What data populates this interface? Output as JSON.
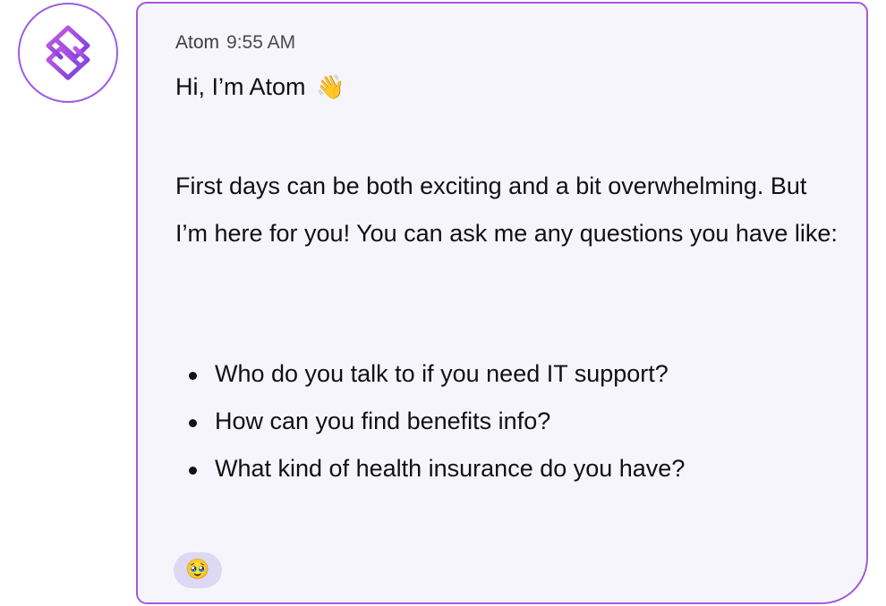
{
  "sender": {
    "name": "Atom",
    "time": "9:55 AM",
    "avatar_icon": "atom-logo-icon"
  },
  "message": {
    "greeting": "Hi, I’m Atom",
    "greeting_emoji": "👋",
    "intro": "First days can be both exciting and a bit overwhelming. But I’m here for you! You can ask me any questions you have like:",
    "examples": [
      "Who do you talk to if you need IT support?",
      "How can you find benefits info?",
      "What kind of health insurance do you have?"
    ]
  },
  "reaction": {
    "emoji": "🥹"
  },
  "colors": {
    "accent": "#9b5de5",
    "bubble_background": "#f6f5fc",
    "reaction_background": "#ddd8f4"
  }
}
